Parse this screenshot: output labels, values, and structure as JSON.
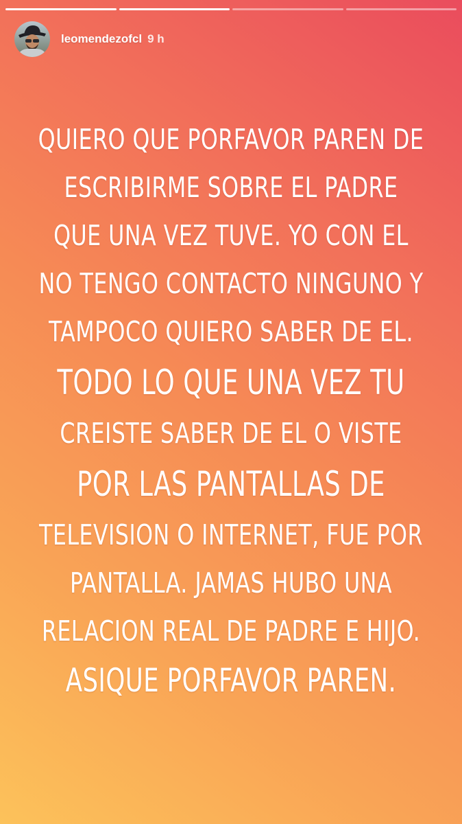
{
  "story": {
    "username": "leomendezofcl",
    "time": "9 h",
    "progress": [
      1,
      1,
      0,
      0
    ],
    "background_gradient": [
      "#fcc25a",
      "#f68a55",
      "#ea4c5d"
    ],
    "lines": [
      "QUIERO QUE PORFAVOR PAREN DE",
      "ESCRIBIRME SOBRE EL PADRE",
      "QUE UNA VEZ TUVE. YO CON EL",
      "NO TENGO CONTACTO NINGUNO Y",
      "TAMPOCO QUIERO SABER DE EL.",
      "TODO LO QUE UNA VEZ TU",
      "CREISTE SABER DE EL O VISTE",
      "POR LAS PANTALLAS DE",
      "TELEVISION O INTERNET, FUE POR",
      "PANTALLA. JAMAS HUBO UNA",
      "RELACION REAL DE PADRE E HIJO.",
      "ASIQUE PORFAVOR PAREN."
    ]
  }
}
